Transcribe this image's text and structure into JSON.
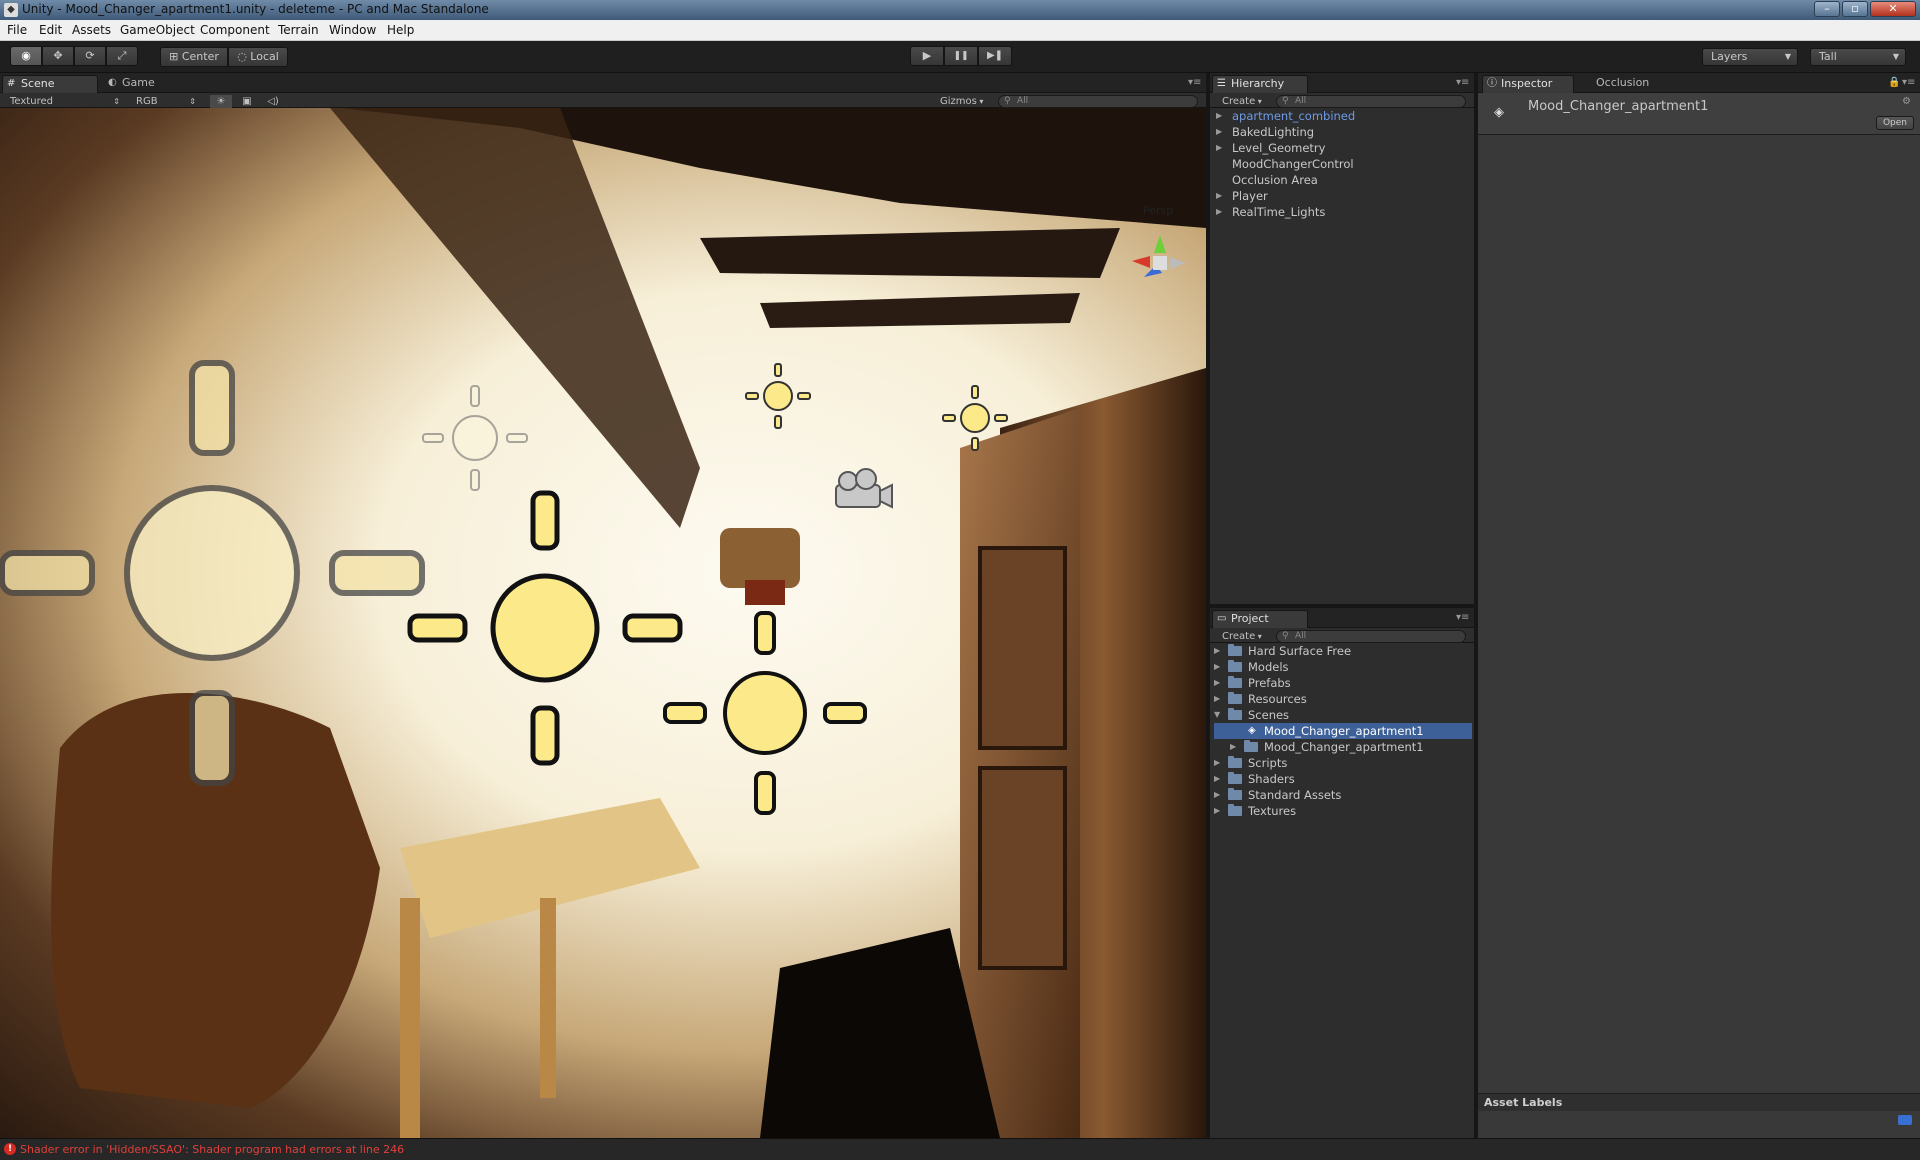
{
  "window": {
    "title": "Unity - Mood_Changer_apartment1.unity - deleteme - PC and Mac Standalone",
    "app_icon": "unity-icon",
    "controls": {
      "minimize": "–",
      "maximize": "▫",
      "close": "✕"
    }
  },
  "menu": [
    "File",
    "Edit",
    "Assets",
    "GameObject",
    "Component",
    "Terrain",
    "Window",
    "Help"
  ],
  "toolbar": {
    "tools": [
      {
        "icon": "eye-icon",
        "glyph": "◉",
        "active": true
      },
      {
        "icon": "move-icon",
        "glyph": "✥",
        "active": false
      },
      {
        "icon": "rotate-icon",
        "glyph": "⟳",
        "active": false
      },
      {
        "icon": "scale-icon",
        "glyph": "⤢",
        "active": false
      }
    ],
    "pivot": "Center",
    "space": "Local",
    "play": "▶",
    "pause": "❚❚",
    "step": "▶❚",
    "layers": "Layers",
    "layout": "Tall"
  },
  "scene_panel": {
    "tabs": [
      "Scene",
      "Game"
    ],
    "tab_icons": [
      "#",
      "◐"
    ],
    "render_mode": "Textured",
    "color_mode": "RGB",
    "gizmos": "Gizmos",
    "search": "All",
    "persp_label": "Persp",
    "panel_menu": "▾≡"
  },
  "hierarchy": {
    "tab": "Hierarchy",
    "create": "Create",
    "search": "All",
    "items": [
      {
        "label": "apartment_combined",
        "arrow": "▶",
        "highlight": true
      },
      {
        "label": "BakedLighting",
        "arrow": "▶"
      },
      {
        "label": "Level_Geometry",
        "arrow": "▶"
      },
      {
        "label": "MoodChangerControl",
        "arrow": ""
      },
      {
        "label": "Occlusion Area",
        "arrow": ""
      },
      {
        "label": "Player",
        "arrow": "▶"
      },
      {
        "label": "RealTime_Lights",
        "arrow": "▶"
      }
    ]
  },
  "project": {
    "tab": "Project",
    "create": "Create",
    "search": "All",
    "items": [
      {
        "label": "Hard Surface Free",
        "arrow": "▶",
        "depth": 0
      },
      {
        "label": "Models",
        "arrow": "▶",
        "depth": 0
      },
      {
        "label": "Prefabs",
        "arrow": "▶",
        "depth": 0
      },
      {
        "label": "Resources",
        "arrow": "▶",
        "depth": 0
      },
      {
        "label": "Scenes",
        "arrow": "▼",
        "depth": 0
      },
      {
        "label": "Mood_Changer_apartment1",
        "arrow": "",
        "depth": 1,
        "selected": true,
        "scene": true
      },
      {
        "label": "Mood_Changer_apartment1",
        "arrow": "▶",
        "depth": 1
      },
      {
        "label": "Scripts",
        "arrow": "▶",
        "depth": 0
      },
      {
        "label": "Shaders",
        "arrow": "▶",
        "depth": 0
      },
      {
        "label": "Standard Assets",
        "arrow": "▶",
        "depth": 0
      },
      {
        "label": "Textures",
        "arrow": "▶",
        "depth": 0
      }
    ]
  },
  "inspector": {
    "tabs": [
      "Inspector",
      "Occlusion"
    ],
    "object_name": "Mood_Changer_apartment1",
    "open_button": "Open",
    "asset_labels": "Asset Labels"
  },
  "status": {
    "message": "Shader error in 'Hidden/SSAO': Shader program had errors at line 246"
  }
}
